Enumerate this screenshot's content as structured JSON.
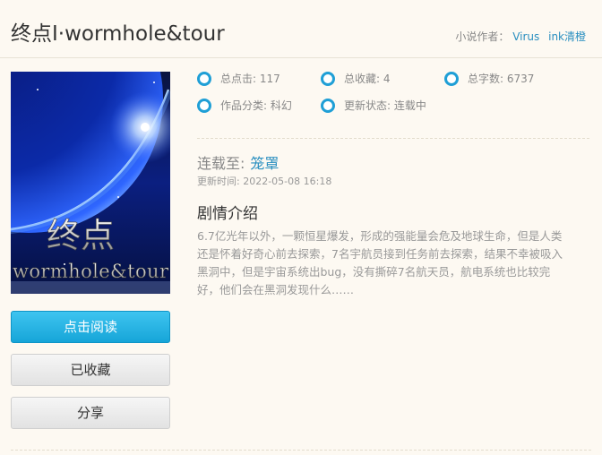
{
  "book": {
    "title": "终点Ⅰ·wormhole&tour",
    "author_label": "小说作者：",
    "author_names": [
      "Virus",
      "ink清橙"
    ]
  },
  "cover": {
    "text_line1": "终点",
    "text_line2": "wormhole&tour"
  },
  "stats": {
    "clicks": "总点击: 117",
    "favorites": "总收藏: 4",
    "words": "总字数: 6737",
    "category": "作品分类: 科幻",
    "status": "更新状态: 连载中"
  },
  "latest": {
    "label": "连载至:",
    "chapter": "笼罩",
    "update_time": "更新时间: 2022-05-08 16:18"
  },
  "intro": {
    "heading": "剧情介绍",
    "text": "6.7亿光年以外，一颗恒星爆发，形成的强能量会危及地球生命，但是人类还是怀着好奇心前去探索，7名宇航员接到任务前去探索，结果不幸被吸入黑洞中，但是宇宙系统出bug，没有撕碎7名航天员，航电系统也比较完好，他们会在黑洞发现什么……"
  },
  "buttons": {
    "read": "点击阅读",
    "favorited": "已收藏",
    "share": "分享"
  },
  "colors": {
    "accent": "#1f9fd6",
    "link": "#2a8fc0",
    "background": "#fdf9f2"
  }
}
